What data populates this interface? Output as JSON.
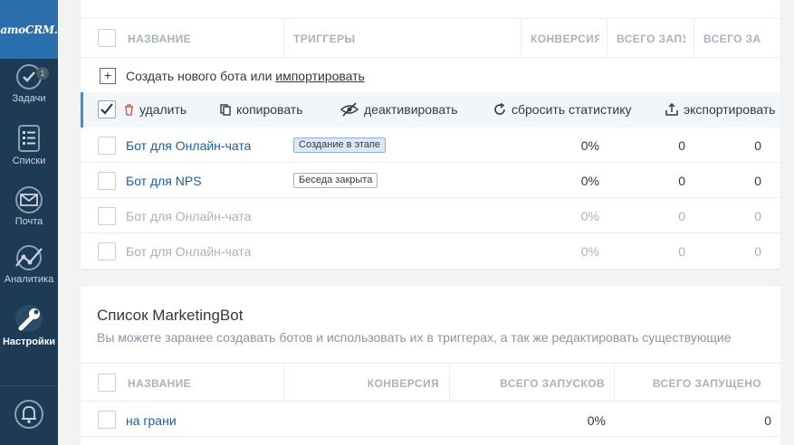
{
  "sidebar": {
    "logo": "amoCRM.",
    "tasks_badge": "1",
    "items": [
      {
        "label": "Задачи",
        "icon": "tasks-icon"
      },
      {
        "label": "Списки",
        "icon": "lists-icon"
      },
      {
        "label": "Почта",
        "icon": "mail-icon"
      },
      {
        "label": "Аналитика",
        "icon": "analytics-icon"
      },
      {
        "label": "Настройки",
        "icon": "settings-icon",
        "active": true
      },
      {
        "label": "",
        "icon": "bell-icon"
      }
    ]
  },
  "bots_table": {
    "columns": [
      "Название",
      "Триггеры",
      "Конверсия",
      "Всего запу",
      "Всего за"
    ],
    "create_text": "Создать нового бота или ",
    "import_link": "импортировать",
    "actions": {
      "delete": "удалить",
      "copy": "копировать",
      "deactivate": "деактивировать",
      "reset": "сбросить статистику",
      "export": "экспортировать"
    },
    "rows": [
      {
        "name": "Бот для Онлайн-чата",
        "trigger": "Создание в этапе",
        "conversion": "0%",
        "total1": "0",
        "total2": "0",
        "active": true
      },
      {
        "name": "Бот для NPS",
        "trigger": "Беседа закрыта",
        "conversion": "0%",
        "total1": "0",
        "total2": "0",
        "active": true
      },
      {
        "name": "Бот для Онлайн-чата",
        "trigger": "",
        "conversion": "0%",
        "total1": "0",
        "total2": "0",
        "active": false
      },
      {
        "name": "Бот для Онлайн-чата",
        "trigger": "",
        "conversion": "0%",
        "total1": "0",
        "total2": "0",
        "active": false
      }
    ]
  },
  "marketing": {
    "title": "Список MarketingBot",
    "subtitle": "Вы можете заранее создавать ботов и использовать их в триггерах, а так же редактировать существующие",
    "columns": [
      "Название",
      "Конверсия",
      "Всего запусков",
      "Всего запущено"
    ],
    "rows": [
      {
        "name": "на грани",
        "conversion": "0%",
        "total": "0"
      }
    ]
  },
  "colors": {
    "sidebar": "#1d3b55",
    "logo_bg": "#2a6fac",
    "link": "#1f5b98",
    "accent": "#3d8fd6"
  }
}
